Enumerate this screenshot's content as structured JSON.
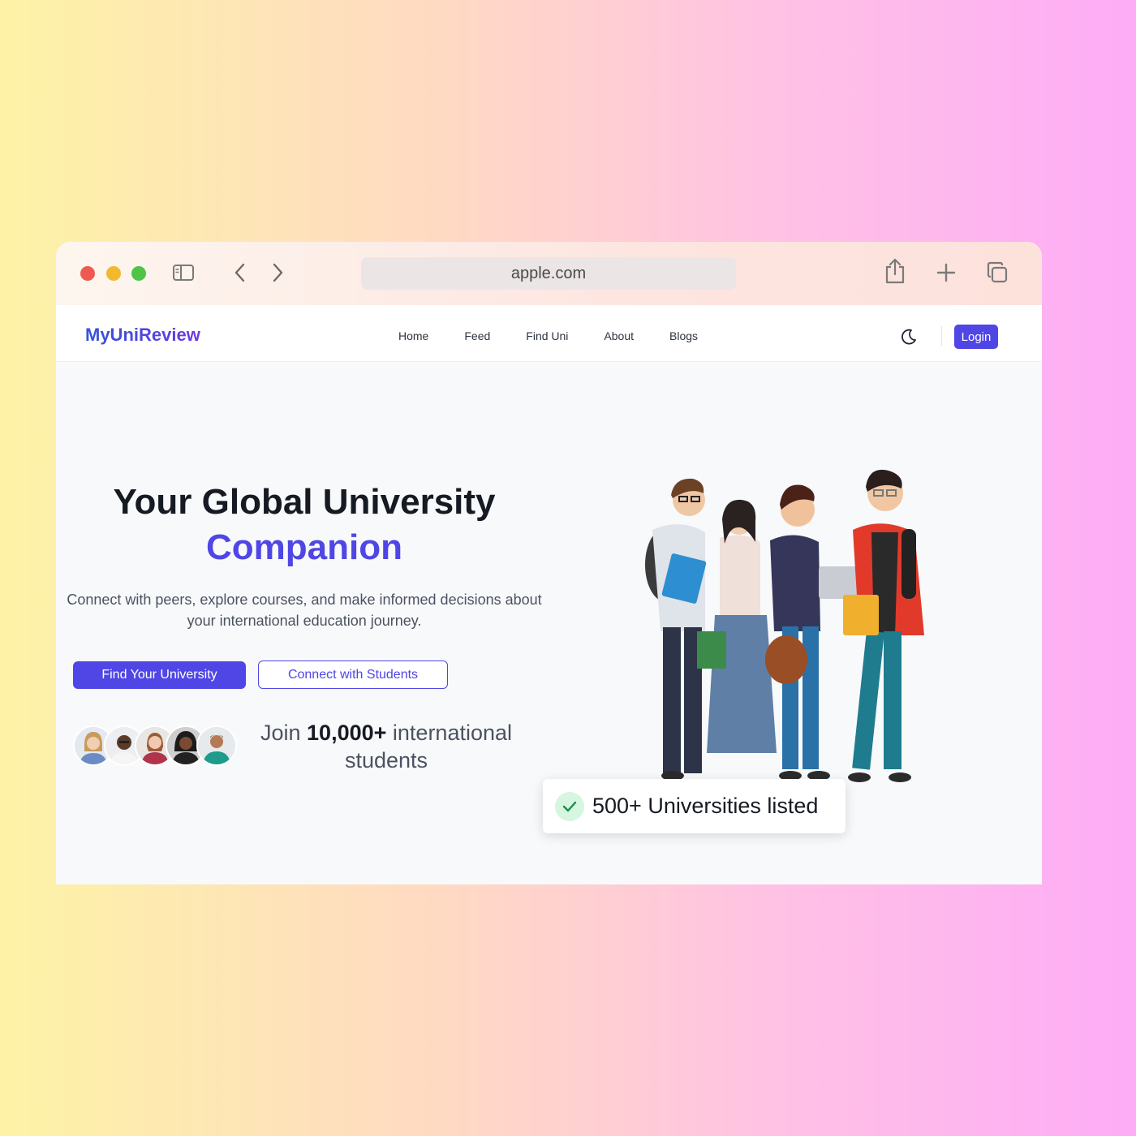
{
  "browser": {
    "url": "apple.com",
    "icons": [
      "sidebar-icon",
      "back-icon",
      "forward-icon",
      "share-icon",
      "new-tab-icon",
      "tabs-icon"
    ]
  },
  "nav": {
    "brand": "MyUniReview",
    "links": [
      "Home",
      "Feed",
      "Find Uni",
      "About",
      "Blogs"
    ],
    "login": "Login"
  },
  "hero": {
    "title_line1": "Your Global University",
    "title_line2": "Companion",
    "description": "Connect with peers, explore courses, and make informed decisions about your international education journey.",
    "primary_button": "Find Your University",
    "secondary_button": "Connect with Students",
    "join_prefix": "Join",
    "join_count": "10,000+",
    "join_suffix": "international students"
  },
  "badge": {
    "text": "500+ Universities listed"
  },
  "colors": {
    "accent": "#4f46e5",
    "brand_gradient_start": "#3553d8",
    "brand_gradient_end": "#6d3ae0"
  }
}
